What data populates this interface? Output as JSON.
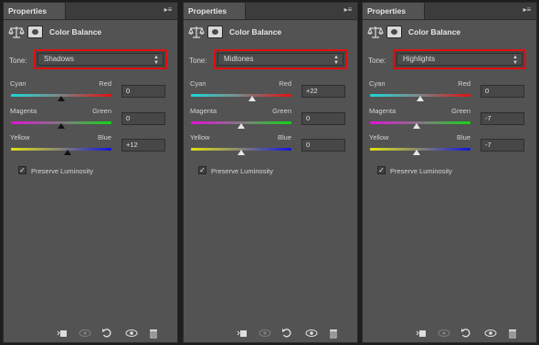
{
  "panels": [
    {
      "tab_title": "Properties",
      "header_title": "Color Balance",
      "tone_label": "Tone:",
      "tone_value": "Shadows",
      "sliders": [
        {
          "left": "Cyan",
          "right": "Red",
          "value": "0",
          "level": 0
        },
        {
          "left": "Magenta",
          "right": "Green",
          "value": "0",
          "level": 0
        },
        {
          "left": "Yellow",
          "right": "Blue",
          "value": "+12",
          "level": 12
        }
      ],
      "preserve_luminosity": {
        "label": "Preserve Luminosity",
        "checked": true
      }
    },
    {
      "tab_title": "Properties",
      "header_title": "Color Balance",
      "tone_label": "Tone:",
      "tone_value": "Midtones",
      "sliders": [
        {
          "left": "Cyan",
          "right": "Red",
          "value": "+22",
          "level": 22
        },
        {
          "left": "Magenta",
          "right": "Green",
          "value": "0",
          "level": 0
        },
        {
          "left": "Yellow",
          "right": "Blue",
          "value": "0",
          "level": 0
        }
      ],
      "preserve_luminosity": {
        "label": "Preserve Luminosity",
        "checked": true
      }
    },
    {
      "tab_title": "Properties",
      "header_title": "Color Balance",
      "tone_label": "Tone:",
      "tone_value": "Highlights",
      "sliders": [
        {
          "left": "Cyan",
          "right": "Red",
          "value": "0",
          "level": 0
        },
        {
          "left": "Magenta",
          "right": "Green",
          "value": "-7",
          "level": -7
        },
        {
          "left": "Yellow",
          "right": "Blue",
          "value": "-7",
          "level": -7
        }
      ],
      "preserve_luminosity": {
        "label": "Preserve Luminosity",
        "checked": true
      }
    }
  ],
  "colors": {
    "panel_bg": "#535353",
    "highlight_border": "#e20d0d"
  },
  "footer_icons": [
    "clip-to-layer-icon",
    "visibility-eye-previous-icon",
    "reset-icon",
    "visibility-eye-icon",
    "trash-icon"
  ],
  "menu_icon": "panel-menu-icon",
  "tone_arrow_icon": "up-down-arrow-icon",
  "balance_icon": "scales-icon",
  "mask_icon": "layer-mask-icon",
  "check_icon": "checkmark-icon"
}
